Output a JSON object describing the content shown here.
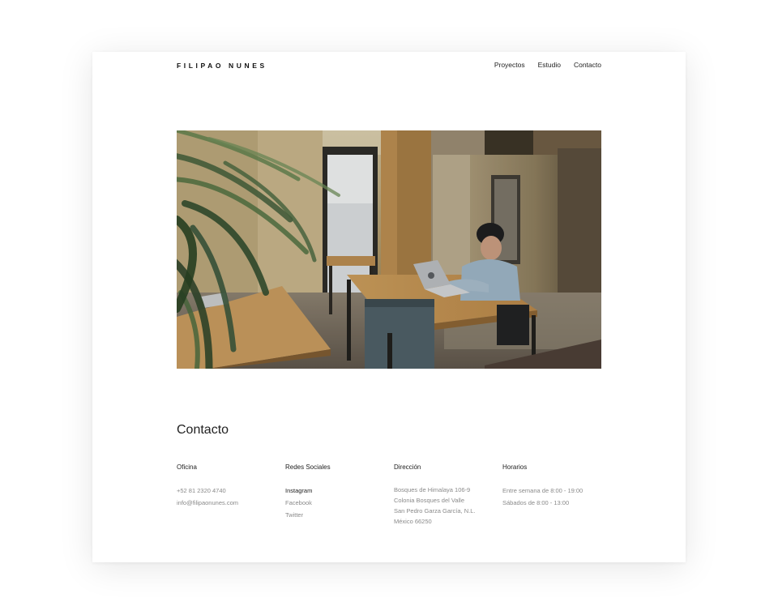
{
  "header": {
    "brand": "FILIPAO NUNES",
    "nav": [
      "Proyectos",
      "Estudio",
      "Contacto"
    ]
  },
  "hero": {
    "image": "photo-office-man-laptop"
  },
  "contact": {
    "title": "Contacto",
    "office": {
      "heading": "Oficina",
      "phone": "+52 81 2320 4740",
      "email": "info@filipaonunes.com"
    },
    "social": {
      "heading": "Redes Sociales",
      "links": [
        "Instagram",
        "Facebook",
        "Twitter"
      ]
    },
    "address": {
      "heading": "Dirección",
      "lines": [
        "Bosques de Himalaya 106-9",
        "Colonia Bosques del Valle",
        "San Pedro Garza García, N.L.",
        "México 66250"
      ]
    },
    "hours": {
      "heading": "Horarios",
      "lines": [
        "Entre semana de 8:00 - 19:00",
        "Sábados de 8:00 - 13:00"
      ]
    }
  },
  "colors": {
    "background": "#ffffff",
    "text": "#222222",
    "muted": "#8a8a8a"
  }
}
